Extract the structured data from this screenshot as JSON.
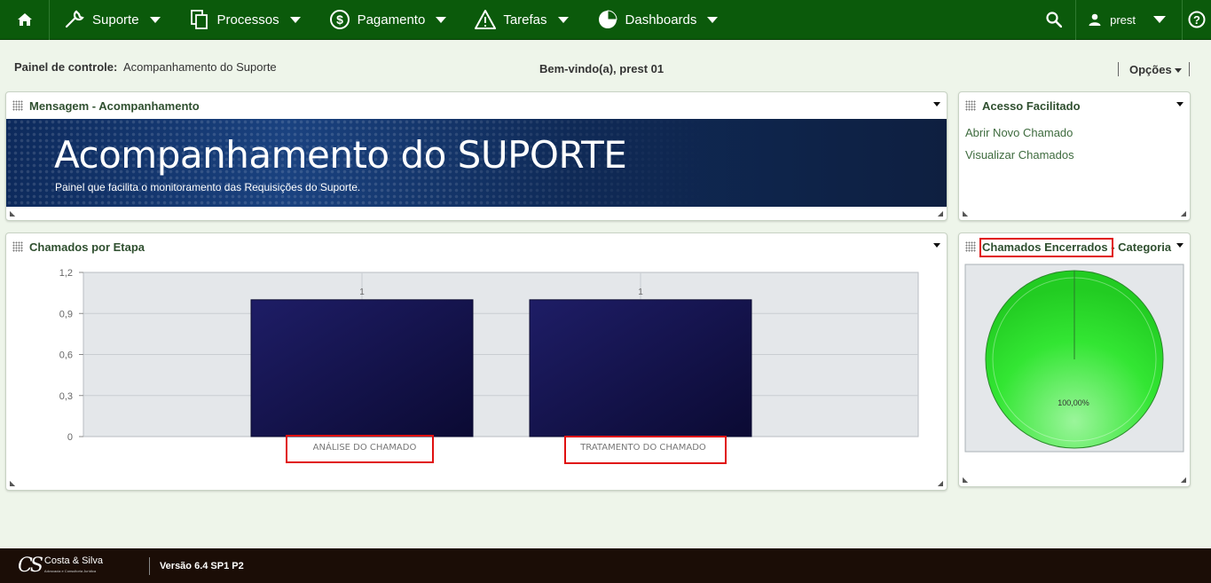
{
  "nav": {
    "home_icon": "home-icon",
    "items": [
      {
        "label": "Suporte",
        "icon": "wrench-icon"
      },
      {
        "label": "Processos",
        "icon": "copy-icon"
      },
      {
        "label": "Pagamento",
        "icon": "dollar-icon"
      },
      {
        "label": "Tarefas",
        "icon": "warning-icon"
      },
      {
        "label": "Dashboards",
        "icon": "pie-icon"
      }
    ],
    "user": "prest",
    "bar_color": "#0b5a0b"
  },
  "subheader": {
    "label": "Painel de controle:",
    "value": "Acompanhamento do Suporte",
    "welcome": "Bem-vindo(a), prest 01",
    "options": "Opções"
  },
  "panels": {
    "message": {
      "title": "Mensagem - Acompanhamento",
      "banner_title": "Acompanhamento do SUPORTE",
      "banner_subtitle": "Painel que facilita o monitoramento das Requisições do Suporte."
    },
    "quick_access": {
      "title": "Acesso Facilitado",
      "links": [
        "Abrir Novo Chamado",
        "Visualizar Chamados"
      ]
    },
    "stage_chart": {
      "title": "Chamados por Etapa"
    },
    "closed_chart": {
      "title": "Chamados Encerrados - Categoria"
    }
  },
  "chart_data": [
    {
      "type": "bar",
      "title": "Chamados por Etapa",
      "categories": [
        "ANÁLISE DO CHAMADO",
        "TRATAMENTO DO CHAMADO"
      ],
      "values": [
        1,
        1
      ],
      "data_labels": [
        "1",
        "1"
      ],
      "y_ticks": [
        "1,2",
        "0,9",
        "0,6",
        "0,3",
        "0"
      ],
      "ylim": [
        0,
        1.2
      ],
      "grid": true,
      "bar_color": "#14134a"
    },
    {
      "type": "pie",
      "title": "Chamados Encerrados - Categoria",
      "values": [
        100
      ],
      "data_labels": [
        "100,00%"
      ],
      "slice_color": "#33e633"
    }
  ],
  "footer": {
    "logo_text": "Costa & Silva",
    "logo_sub": "Advocacia e Consultoria Jurídica",
    "version": "Versão 6.4 SP1 P2"
  }
}
